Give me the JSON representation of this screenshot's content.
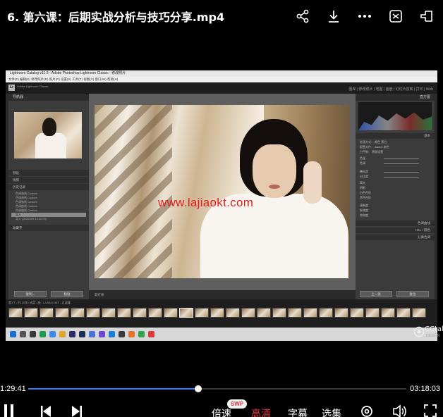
{
  "header": {
    "title": "6. 第六课：后期实战分析与技巧分享.mp4",
    "icons": [
      "share-icon",
      "download-icon",
      "more-icon",
      "screenshot-icon",
      "pip-icon"
    ]
  },
  "video": {
    "app_titlebar": "Lightroom Catalog-v11-2 - Adobe Photoshop Lightroom Classic - 修改照片",
    "menu": "文件(F)  编辑(E)  修改照片(D)  照片(P)  设置(S)  工具(T)  视图(V)  窗口(W)  帮助(H)",
    "catalog_label": "Adobe Lightroom Classic",
    "modules": "图库 | 修改照片 | 地图 | 画册 | 幻灯片放映 | 打印 | Web",
    "left_panel": {
      "navigator": "导航器",
      "sections": [
        "预设",
        "快照",
        "历史记录",
        "收藏夹"
      ],
      "presets": [
        "色调曲线 Custom",
        "色调曲线 Custom",
        "色调曲线 Custom",
        "色调曲线 Custom",
        "色调曲线 Custom",
        "导入",
        "导入 (2020/3/9 13:32:09)"
      ],
      "buttons": [
        "复制...",
        "粘贴"
      ]
    },
    "watermark": "www.lajiaokt.com",
    "center_toolbar": "软打样",
    "right_panel": {
      "header": "直方图",
      "sections": [
        "基本",
        "色调曲线",
        "HSL / 颜色",
        "分离色调"
      ],
      "rows": [
        "处理方式：  颜色  黑白",
        "配置文件：  Adobe 颜色",
        "白平衡：  原照设置",
        "色温",
        "色调",
        "曝光度",
        "对比度",
        "高光",
        "阴影",
        "白色色阶",
        "黑色色阶",
        "清晰度",
        "鲜艳度",
        "饱和度"
      ],
      "buttons": [
        "上一张",
        "复位"
      ]
    },
    "filmstrip_info": "第1个 / 共 22张 / 选定 1张 / LAJIAO.NEF - 过滤器：",
    "brand": "CCtalk",
    "brand_sub": "DESIGN"
  },
  "player": {
    "current_time": "1:29:41",
    "end_time": "03:18:03",
    "progress": 0.45,
    "buttons": {
      "speed": "倍速",
      "quality": "高清",
      "subtitle": "字幕",
      "episodes": "选集"
    },
    "swp_badge": "SWP"
  },
  "colors": {
    "accent": "#2b7fff",
    "quality_active": "#e8344a",
    "watermark": "#e32020"
  }
}
